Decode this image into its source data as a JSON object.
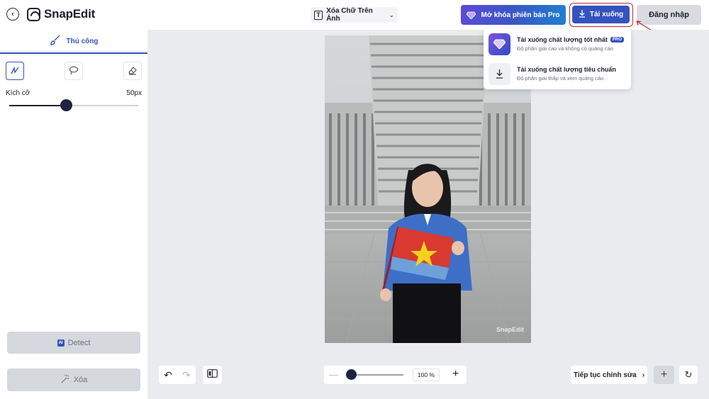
{
  "header": {
    "app_name": "SnapEdit",
    "tool_select_label": "Xóa Chữ Trên Ảnh",
    "pro_button_label": "Mở khóa phiên bản Pro",
    "download_button_label": "Tải xuống",
    "login_button_label": "Đăng nhập"
  },
  "sidebar": {
    "tab_label": "Thủ công",
    "size_label": "Kích cỡ",
    "size_value": "50px",
    "size_fraction": 0.44,
    "detect_label": "Detect",
    "detect_badge": "AI",
    "erase_label": "Xóa"
  },
  "download_menu": {
    "items": [
      {
        "title": "Tải xuống chất lượng tốt nhất",
        "badge": "PRO",
        "subtitle": "Độ phân giải cao và không có quảng cáo"
      },
      {
        "title": "Tải xuống chất lượng tiêu chuẩn",
        "subtitle": "Độ phân giải thấp và xem quảng cáo"
      }
    ]
  },
  "canvas": {
    "watermark": "SnapEdit"
  },
  "toolbar": {
    "zoom_value": "100 %",
    "zoom_fraction": 0.08,
    "continue_label": "Tiếp tục chỉnh sửa"
  },
  "colors": {
    "accent": "#3553bf",
    "annotation": "#c4253c"
  }
}
